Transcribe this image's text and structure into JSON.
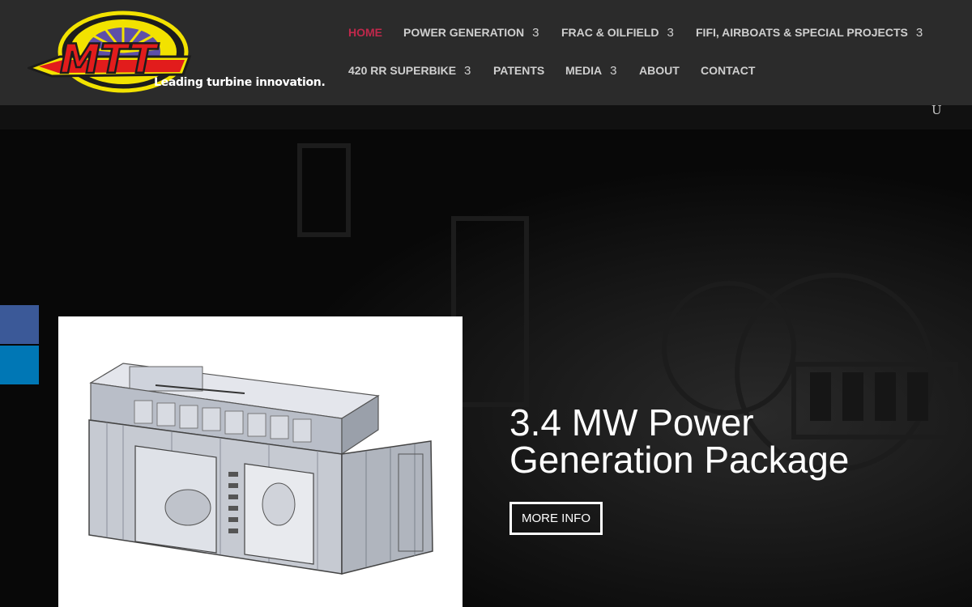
{
  "brand": {
    "logo_text": "MTT",
    "tagline": "Leading turbine innovation."
  },
  "nav": {
    "items": [
      {
        "label": "HOME",
        "active": true,
        "has_submenu": false
      },
      {
        "label": "POWER GENERATION",
        "has_submenu": true
      },
      {
        "label": "FRAC & OILFIELD",
        "has_submenu": true
      },
      {
        "label": "FIFI, AIRBOATS & SPECIAL PROJECTS",
        "has_submenu": true
      },
      {
        "label": "420 RR SUPERBIKE",
        "has_submenu": true
      },
      {
        "label": "PATENTS",
        "has_submenu": false
      },
      {
        "label": "MEDIA",
        "has_submenu": true
      },
      {
        "label": "ABOUT",
        "has_submenu": false
      },
      {
        "label": "CONTACT",
        "has_submenu": false
      }
    ],
    "submenu_glyph": "3",
    "search_glyph": "U",
    "active_color": "#c0284b"
  },
  "social": {
    "icons": [
      "facebook-icon",
      "linkedin-icon"
    ],
    "colors": [
      "#3b5998",
      "#0077b5"
    ]
  },
  "hero": {
    "title_line1": "3.4 MW Power",
    "title_line2": "Generation Package",
    "button_label": "MORE INFO",
    "image": "power-generation-container-render"
  }
}
